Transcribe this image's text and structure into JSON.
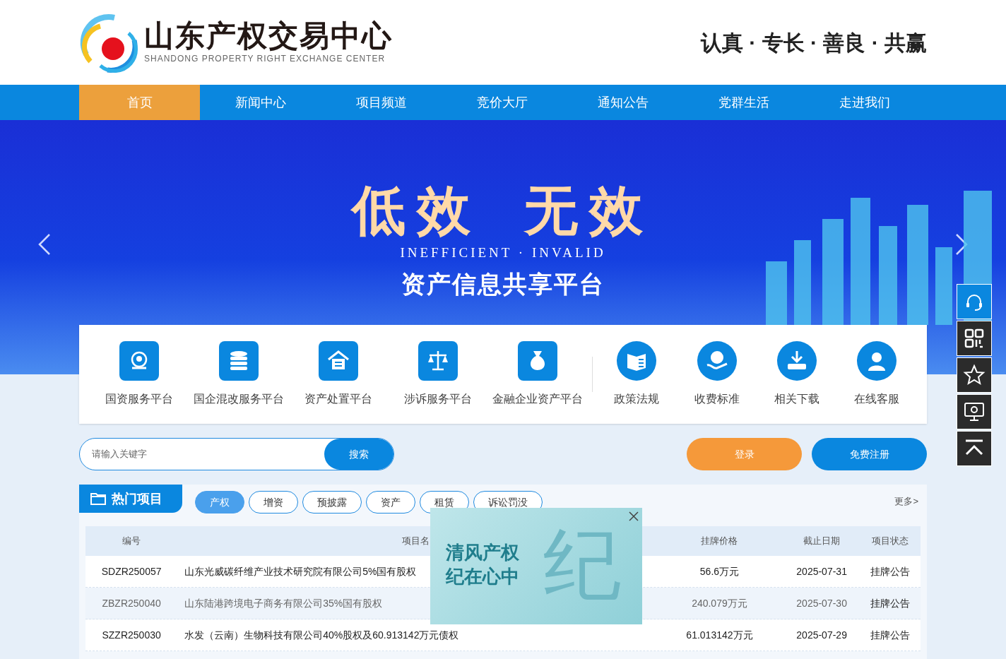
{
  "header": {
    "logo_title": "山东产权交易中心",
    "logo_subtitle": "SHANDONG PROPERTY RIGHT EXCHANGE CENTER",
    "slogan": "认真 · 专长 · 善良 · 共赢"
  },
  "nav": [
    {
      "label": "首页",
      "selected": true
    },
    {
      "label": "新闻中心",
      "selected": false
    },
    {
      "label": "项目频道",
      "selected": false
    },
    {
      "label": "竞价大厅",
      "selected": false
    },
    {
      "label": "通知公告",
      "selected": false
    },
    {
      "label": "党群生活",
      "selected": false
    },
    {
      "label": "走进我们",
      "selected": false
    }
  ],
  "banner": {
    "headline_1": "低效",
    "headline_2": "无效",
    "subtitle": "INEFFICIENT · INVALID",
    "tagline": "资产信息共享平台"
  },
  "services": [
    {
      "label": "国资服务平台",
      "kind": "square"
    },
    {
      "label": "国企混改服务平台",
      "kind": "square"
    },
    {
      "label": "资产处置平台",
      "kind": "square"
    },
    {
      "label": "涉诉服务平台",
      "kind": "square"
    },
    {
      "label": "金融企业资产平台",
      "kind": "square"
    },
    {
      "label": "政策法规",
      "kind": "circle"
    },
    {
      "label": "收费标准",
      "kind": "circle"
    },
    {
      "label": "相关下载",
      "kind": "circle"
    },
    {
      "label": "在线客服",
      "kind": "circle"
    }
  ],
  "search": {
    "placeholder": "请输入关键字",
    "button": "搜索"
  },
  "login_button": "登录",
  "register_button": "免费注册",
  "hot_projects": {
    "title": "热门项目",
    "more": "更多>",
    "tabs": [
      {
        "label": "产权",
        "selected": true
      },
      {
        "label": "增资",
        "selected": false
      },
      {
        "label": "预披露",
        "selected": false
      },
      {
        "label": "资产",
        "selected": false
      },
      {
        "label": "租赁",
        "selected": false
      },
      {
        "label": "诉讼罚没",
        "selected": false
      }
    ],
    "columns": [
      "编号",
      "项目名",
      "挂牌价格",
      "截止日期",
      "项目状态"
    ],
    "rows": [
      {
        "id": "SDZR250057",
        "name": "山东光威碳纤维产业技术研究院有限公司5%国有股权",
        "price": "56.6万元",
        "deadline": "2025-07-31",
        "status": "挂牌公告",
        "highlighted": false
      },
      {
        "id": "ZBZR250040",
        "name": "山东陆港跨境电子商务有限公司35%国有股权",
        "price": "240.079万元",
        "deadline": "2025-07-30",
        "status": "挂牌公告",
        "highlighted": true
      },
      {
        "id": "SZZR250030",
        "name": "水发（云南）生物科技有限公司40%股权及60.913142万元债权",
        "price": "61.013142万元",
        "deadline": "2025-07-29",
        "status": "挂牌公告",
        "highlighted": false
      }
    ]
  },
  "popup": {
    "line_1": "清风产权",
    "line_2": "纪在心中",
    "glyph": "纪"
  },
  "side_toolbar": [
    {
      "selected": true
    },
    {
      "selected": false
    },
    {
      "selected": false
    },
    {
      "selected": false
    },
    {
      "selected": false
    }
  ]
}
